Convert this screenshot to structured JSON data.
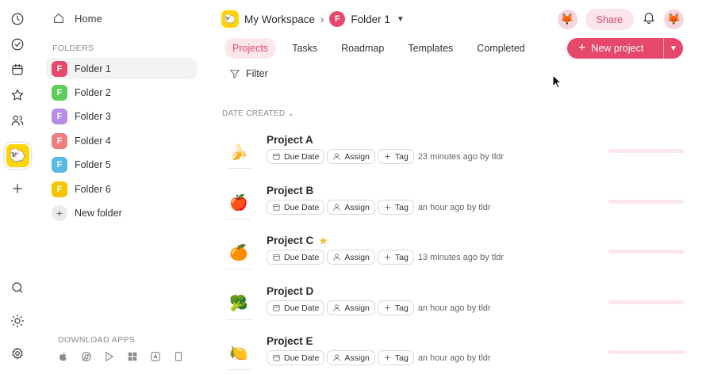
{
  "rail": {
    "icons": [
      "clock-icon",
      "check-circle-icon",
      "calendar-icon",
      "star-icon",
      "users-icon",
      "plus-icon",
      "search-icon",
      "sun-icon",
      "gear-icon"
    ],
    "workspace_emoji": "🐑"
  },
  "sidebar": {
    "home_label": "Home",
    "folders_label": "FOLDERS",
    "folders": [
      {
        "label": "Folder 1",
        "letter": "F",
        "color": "#e5486a"
      },
      {
        "label": "Folder 2",
        "letter": "F",
        "color": "#5ccf5a"
      },
      {
        "label": "Folder 3",
        "letter": "F",
        "color": "#b98be8"
      },
      {
        "label": "Folder 4",
        "letter": "F",
        "color": "#ef7e7e"
      },
      {
        "label": "Folder 5",
        "letter": "F",
        "color": "#58b9e6"
      },
      {
        "label": "Folder 6",
        "letter": "F",
        "color": "#f7c400"
      }
    ],
    "new_folder_label": "New folder",
    "download_label": "DOWNLOAD APPS",
    "app_icons": [
      "apple-icon",
      "chrome-icon",
      "play-store-icon",
      "windows-icon",
      "app-store-icon",
      "mobile-icon"
    ]
  },
  "header": {
    "workspace_emoji": "🐑",
    "workspace_name": "My Workspace",
    "folder_letter": "F",
    "folder_name": "Folder 1",
    "share_label": "Share",
    "avatar_emoji": "🦊"
  },
  "tabs": [
    "Projects",
    "Tasks",
    "Roadmap",
    "Templates",
    "Completed"
  ],
  "new_project_label": "New project",
  "filter_label": "Filter",
  "sort_label": "DATE CREATED",
  "chip_labels": {
    "due": "Due Date",
    "assign": "Assign",
    "tag": "Tag"
  },
  "projects": [
    {
      "name": "Project A",
      "emoji": "🍌",
      "starred": false,
      "meta": "23 minutes ago by tldr"
    },
    {
      "name": "Project B",
      "emoji": "🍎",
      "starred": false,
      "meta": "an hour ago by tldr"
    },
    {
      "name": "Project C",
      "emoji": "🍊",
      "starred": true,
      "meta": "13 minutes ago by tldr"
    },
    {
      "name": "Project D",
      "emoji": "🥦",
      "starred": false,
      "meta": "an hour ago by tldr"
    },
    {
      "name": "Project E",
      "emoji": "🍋",
      "starred": false,
      "meta": "an hour ago by tldr"
    }
  ],
  "accent_color": "#e5486a"
}
